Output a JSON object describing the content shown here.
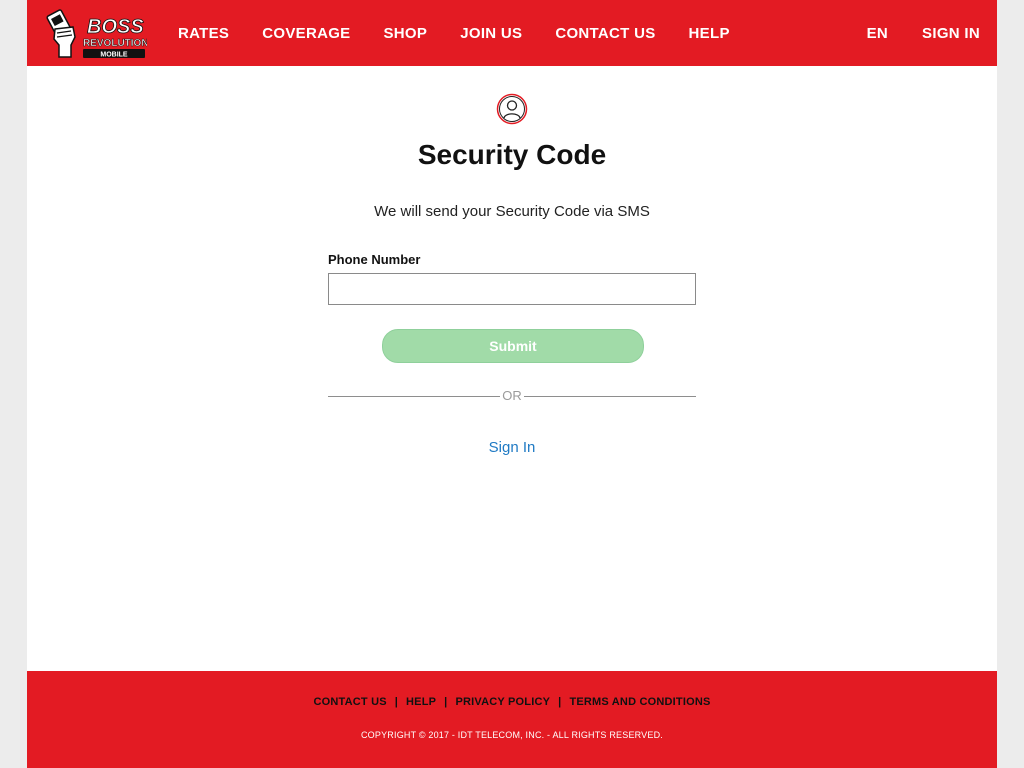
{
  "brand": {
    "logo_line1": "BOSS",
    "logo_line2": "REVOLUTION",
    "logo_line3": "MOBILE",
    "primary_color": "#e31b23",
    "submit_color": "#a1dba8",
    "link_color": "#1f7ac4"
  },
  "header": {
    "nav": [
      "RATES",
      "COVERAGE",
      "SHOP",
      "JOIN US",
      "CONTACT US",
      "HELP"
    ],
    "language": "EN",
    "sign_in": "SIGN IN"
  },
  "main": {
    "icon": "user-circle-icon",
    "title": "Security Code",
    "subtitle": "We will send your Security Code via SMS",
    "phone_label": "Phone Number",
    "phone_value": "",
    "phone_placeholder": "",
    "submit_label": "Submit",
    "divider_text": "OR",
    "signin_link": "Sign In"
  },
  "footer": {
    "links": [
      "CONTACT US",
      "HELP",
      "PRIVACY POLICY",
      "TERMS AND CONDITIONS"
    ],
    "copyright": "COPYRIGHT © 2017 - IDT TELECOM, INC. - ALL RIGHTS RESERVED."
  }
}
